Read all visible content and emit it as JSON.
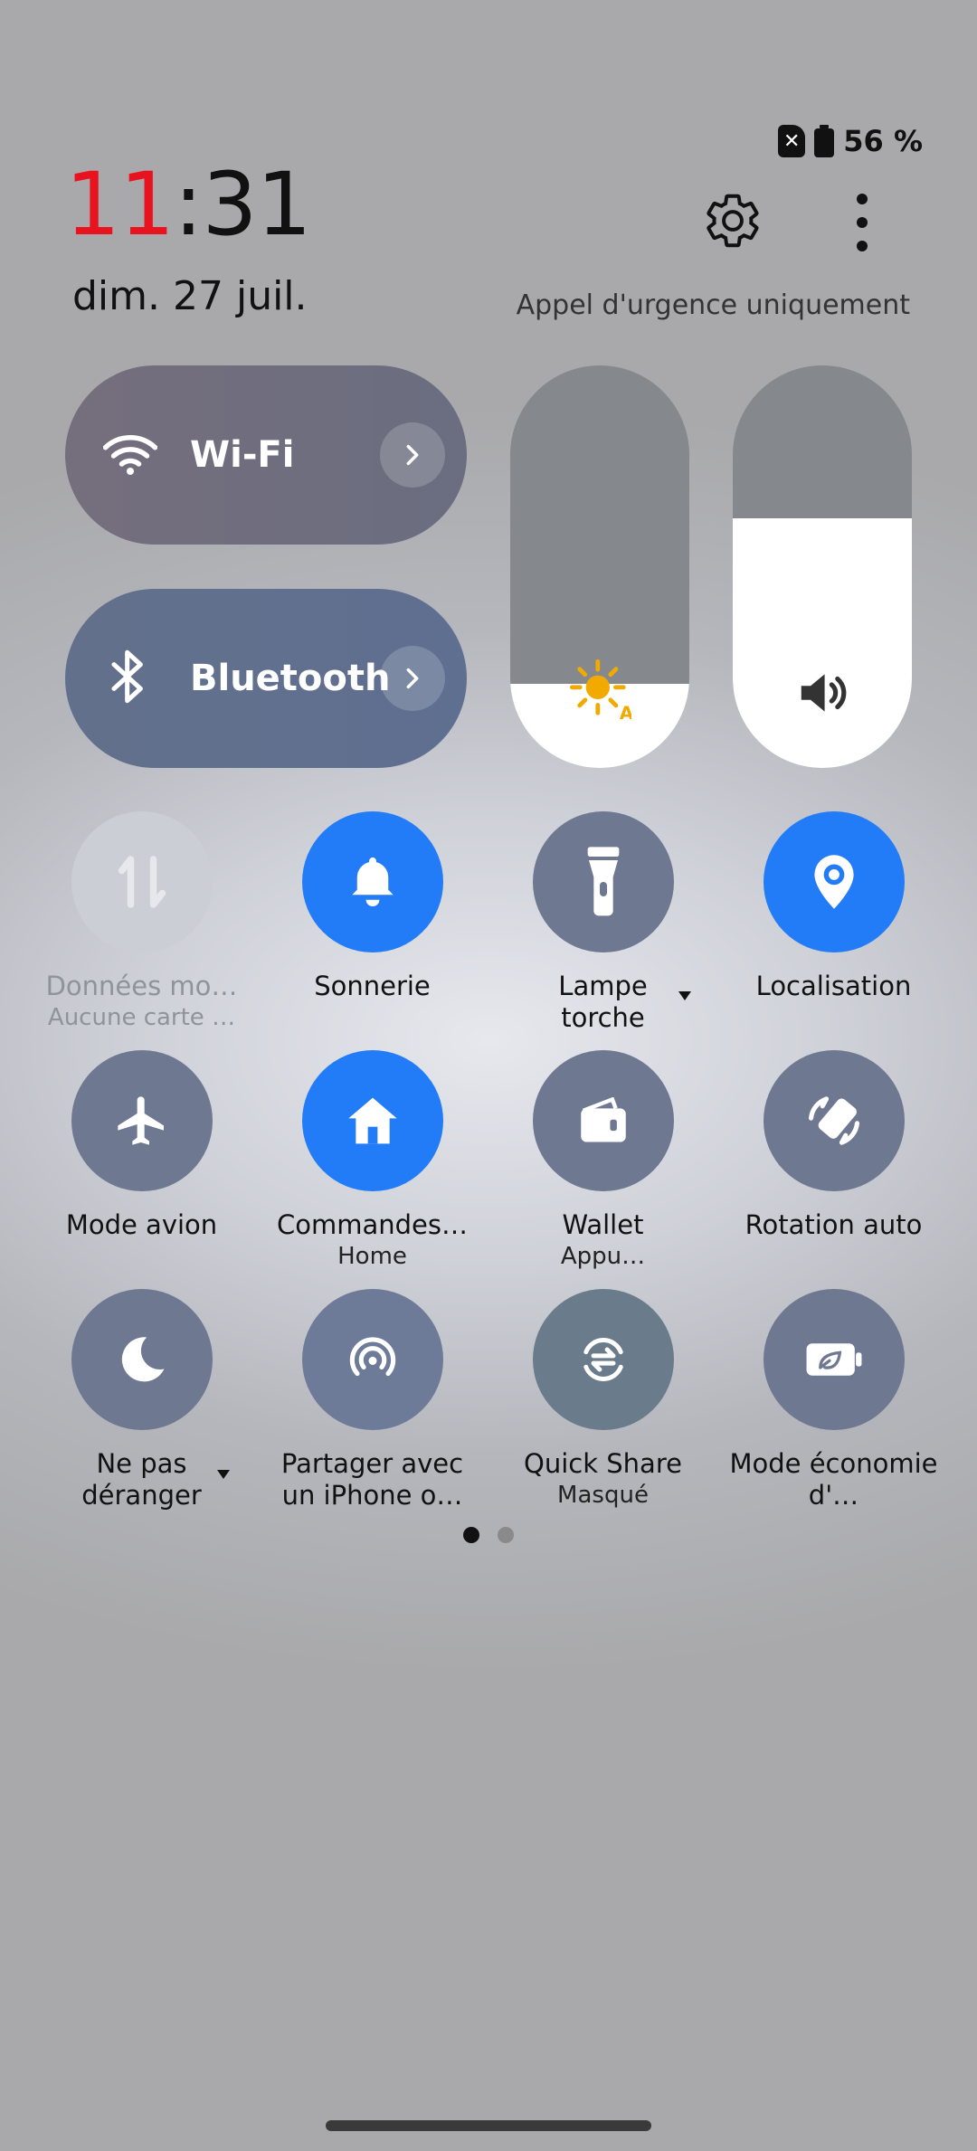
{
  "status": {
    "battery": "56 %",
    "sim": "✕"
  },
  "clock": {
    "hours": "11",
    "colon_minutes": ":31"
  },
  "date": "dim. 27 juil.",
  "emergency": "Appel d'urgence uniquement",
  "pills": {
    "wifi": "Wi-Fi",
    "bluetooth": "Bluetooth"
  },
  "sliders": {
    "brightness_level": 0.21,
    "volume_level": 0.62
  },
  "tiles": [
    {
      "label": "Données mo…",
      "sub": "Aucune carte …",
      "state": "disabled",
      "icon": "mobile-data-icon"
    },
    {
      "label": "Sonnerie",
      "sub": "",
      "state": "on",
      "icon": "bell-icon"
    },
    {
      "label": "Lampe torche",
      "sub": "",
      "state": "off",
      "icon": "flashlight-icon"
    },
    {
      "label": "Localisation",
      "sub": "",
      "state": "on",
      "icon": "location-icon"
    },
    {
      "label": "Mode avion",
      "sub": "",
      "state": "off",
      "icon": "airplane-icon"
    },
    {
      "label": "Commandes…",
      "sub": "Home",
      "state": "on",
      "icon": "home-icon"
    },
    {
      "label": "Wallet",
      "sub": "Appu…",
      "state": "off",
      "icon": "wallet-icon"
    },
    {
      "label": "Rotation auto",
      "sub": "",
      "state": "off",
      "icon": "rotation-icon"
    },
    {
      "label": "Ne pas déranger",
      "sub": "",
      "state": "off",
      "icon": "moon-icon"
    },
    {
      "label": "Partager avec un iPhone o…",
      "sub": "",
      "state": "off",
      "icon": "share-iphone-icon"
    },
    {
      "label": "Quick Share",
      "sub": "Masqué",
      "state": "off",
      "icon": "quick-share-icon"
    },
    {
      "label": "Mode économie d'…",
      "sub": "",
      "state": "off",
      "icon": "battery-saver-icon"
    }
  ],
  "pages": {
    "count": 2,
    "current": 1
  },
  "colors": {
    "accent_blue": "#237cf7",
    "tile_gray": "#6f7891",
    "clock_red": "#e8131f"
  }
}
